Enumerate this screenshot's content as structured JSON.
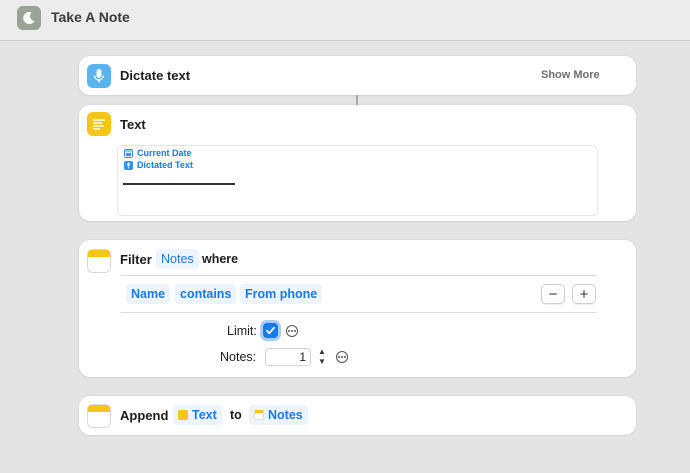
{
  "window": {
    "title": "Take A Note",
    "app_icon": "moon-icon"
  },
  "dictate": {
    "title": "Dictate text",
    "show_more": "Show More",
    "icon_color": "#5ab4f0"
  },
  "text_action": {
    "title": "Text",
    "icon_color": "#f5c518",
    "tokens": [
      {
        "label": "Current Date",
        "icon": "calendar-icon"
      },
      {
        "label": "Dictated Text",
        "icon": "microphone-icon"
      }
    ]
  },
  "filter": {
    "title": "Filter",
    "collection": "Notes",
    "where": "where",
    "condition": {
      "field": "Name",
      "operator": "contains",
      "value": "From phone"
    },
    "remove_label": "−",
    "add_label": "+",
    "limit_label": "Limit:",
    "limit_checked": true,
    "notes_label": "Notes:",
    "notes_value": "1"
  },
  "append": {
    "title": "Append",
    "text_token": "Text",
    "to": "to",
    "notes_token": "Notes"
  },
  "colors": {
    "accent": "#1a7ae8",
    "pill_bg": "#eef4fd",
    "background": "#e4e4e4"
  }
}
